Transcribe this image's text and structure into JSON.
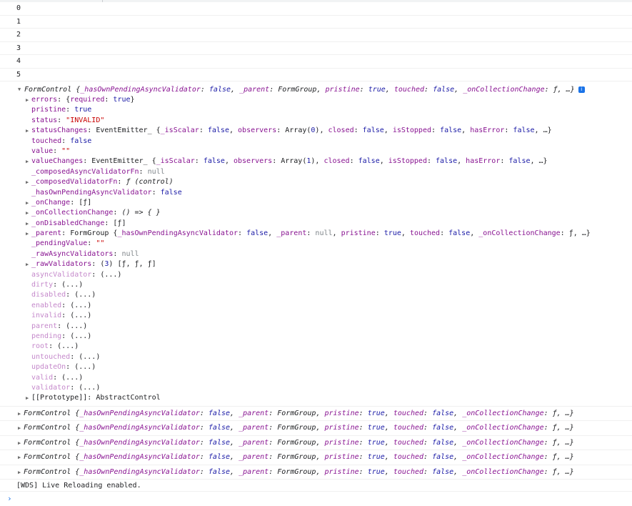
{
  "numbers": [
    "0",
    "1",
    "2",
    "3",
    "4",
    "5"
  ],
  "expanded": {
    "header_name": "FormControl",
    "header_summary": " {_hasOwnPendingAsyncValidator: false, _parent: FormGroup, pristine: true, touched: false, _onCollectionChange: ƒ, …}",
    "info_glyph": "i",
    "props": [
      {
        "key": "errors",
        "sep": ": ",
        "val": "{required: true}",
        "vtype": "obj",
        "expand": true,
        "dim": false
      },
      {
        "key": "pristine",
        "sep": ": ",
        "val": "true",
        "vtype": "b",
        "expand": false,
        "dim": false
      },
      {
        "key": "status",
        "sep": ": ",
        "val": "\"INVALID\"",
        "vtype": "s",
        "expand": false,
        "dim": false
      },
      {
        "key": "statusChanges",
        "sep": ": ",
        "val": "EventEmitter_ {_isScalar: false, observers: Array(0), closed: false, isStopped: false, hasError: false, …}",
        "vtype": "obj",
        "expand": true,
        "dim": false
      },
      {
        "key": "touched",
        "sep": ": ",
        "val": "false",
        "vtype": "b",
        "expand": false,
        "dim": false
      },
      {
        "key": "value",
        "sep": ": ",
        "val": "\"\"",
        "vtype": "s",
        "expand": false,
        "dim": false
      },
      {
        "key": "valueChanges",
        "sep": ": ",
        "val": "EventEmitter_ {_isScalar: false, observers: Array(1), closed: false, isStopped: false, hasError: false, …}",
        "vtype": "obj",
        "expand": true,
        "dim": false
      },
      {
        "key": "_composedAsyncValidatorFn",
        "sep": ": ",
        "val": "null",
        "vtype": "g",
        "expand": false,
        "dim": false
      },
      {
        "key": "_composedValidatorFn",
        "sep": ": ",
        "val": "ƒ (control)",
        "vtype": "fn",
        "expand": true,
        "dim": false
      },
      {
        "key": "_hasOwnPendingAsyncValidator",
        "sep": ": ",
        "val": "false",
        "vtype": "b",
        "expand": false,
        "dim": false
      },
      {
        "key": "_onChange",
        "sep": ": ",
        "val": "[ƒ]",
        "vtype": "obj",
        "expand": true,
        "dim": false
      },
      {
        "key": "_onCollectionChange",
        "sep": ": ",
        "val": "() => { }",
        "vtype": "fn",
        "expand": true,
        "dim": false
      },
      {
        "key": "_onDisabledChange",
        "sep": ": ",
        "val": "[ƒ]",
        "vtype": "obj",
        "expand": true,
        "dim": false
      },
      {
        "key": "_parent",
        "sep": ": ",
        "val": "FormGroup {_hasOwnPendingAsyncValidator: false, _parent: null, pristine: true, touched: false, _onCollectionChange: ƒ, …}",
        "vtype": "obj",
        "expand": true,
        "dim": false
      },
      {
        "key": "_pendingValue",
        "sep": ": ",
        "val": "\"\"",
        "vtype": "s",
        "expand": false,
        "dim": false
      },
      {
        "key": "_rawAsyncValidators",
        "sep": ": ",
        "val": "null",
        "vtype": "g",
        "expand": false,
        "dim": false
      },
      {
        "key": "_rawValidators",
        "sep": ": ",
        "val": "(3) [ƒ, ƒ, ƒ]",
        "vtype": "obj",
        "expand": true,
        "dim": false
      },
      {
        "key": "asyncValidator",
        "sep": ": ",
        "val": "(...)",
        "vtype": "obj",
        "expand": false,
        "dim": true
      },
      {
        "key": "dirty",
        "sep": ": ",
        "val": "(...)",
        "vtype": "obj",
        "expand": false,
        "dim": true
      },
      {
        "key": "disabled",
        "sep": ": ",
        "val": "(...)",
        "vtype": "obj",
        "expand": false,
        "dim": true
      },
      {
        "key": "enabled",
        "sep": ": ",
        "val": "(...)",
        "vtype": "obj",
        "expand": false,
        "dim": true
      },
      {
        "key": "invalid",
        "sep": ": ",
        "val": "(...)",
        "vtype": "obj",
        "expand": false,
        "dim": true
      },
      {
        "key": "parent",
        "sep": ": ",
        "val": "(...)",
        "vtype": "obj",
        "expand": false,
        "dim": true
      },
      {
        "key": "pending",
        "sep": ": ",
        "val": "(...)",
        "vtype": "obj",
        "expand": false,
        "dim": true
      },
      {
        "key": "root",
        "sep": ": ",
        "val": "(...)",
        "vtype": "obj",
        "expand": false,
        "dim": true
      },
      {
        "key": "untouched",
        "sep": ": ",
        "val": "(...)",
        "vtype": "obj",
        "expand": false,
        "dim": true
      },
      {
        "key": "updateOn",
        "sep": ": ",
        "val": "(...)",
        "vtype": "obj",
        "expand": false,
        "dim": true
      },
      {
        "key": "valid",
        "sep": ": ",
        "val": "(...)",
        "vtype": "obj",
        "expand": false,
        "dim": true
      },
      {
        "key": "validator",
        "sep": ": ",
        "val": "(...)",
        "vtype": "obj",
        "expand": false,
        "dim": true
      },
      {
        "key": "[[Prototype]]",
        "sep": ": ",
        "val": "AbstractControl",
        "vtype": "obj",
        "expand": true,
        "dim": false,
        "proto": true
      }
    ]
  },
  "collapsed": [
    {
      "name": "FormControl",
      "summary": " {_hasOwnPendingAsyncValidator: false, _parent: FormGroup, pristine: true, touched: false, _onCollectionChange: ƒ, …}"
    },
    {
      "name": "FormControl",
      "summary": " {_hasOwnPendingAsyncValidator: false, _parent: FormGroup, pristine: true, touched: false, _onCollectionChange: ƒ, …}"
    },
    {
      "name": "FormControl",
      "summary": " {_hasOwnPendingAsyncValidator: false, _parent: FormGroup, pristine: true, touched: false, _onCollectionChange: ƒ, …}"
    },
    {
      "name": "FormControl",
      "summary": " {_hasOwnPendingAsyncValidator: false, _parent: FormGroup, pristine: true, touched: false, _onCollectionChange: ƒ, …}"
    },
    {
      "name": "FormControl",
      "summary": " {_hasOwnPendingAsyncValidator: false, _parent: FormGroup, pristine: true, touched: false, _onCollectionChange: ƒ, …}"
    }
  ],
  "wds_message": "[WDS] Live Reloading enabled.",
  "prompt_glyph": "›",
  "expand_glyph_open": "▼",
  "expand_glyph_closed": "▶",
  "colors": {
    "key": "#881391",
    "string": "#c80000",
    "boolean": "#1a1aa6",
    "null": "#80868b",
    "accent": "#1a73e8"
  }
}
